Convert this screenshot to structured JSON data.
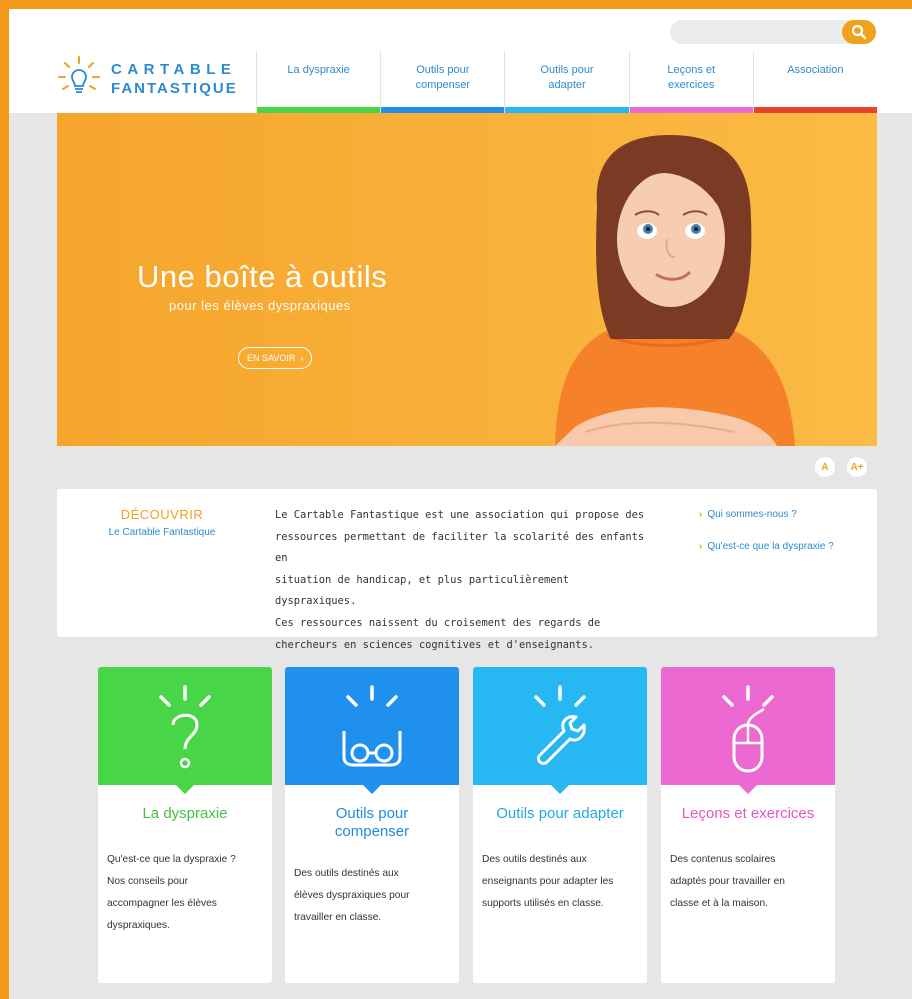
{
  "colors": {
    "frame": "#f39a1c",
    "accent_orange": "#f0a21f",
    "link_blue": "#2d8bd1",
    "green": "#48d547",
    "blue": "#1f90ee",
    "cyan": "#27b7f2",
    "pink": "#ec69d2",
    "red": "#e8422b"
  },
  "search": {
    "value": "",
    "placeholder": "",
    "icon": "search-icon"
  },
  "logo": {
    "line1": "CARTABLE",
    "line2": "FANTASTIQUE",
    "icon": "lightbulb-icon"
  },
  "nav": [
    {
      "line1": "La dyspraxie",
      "line2": "",
      "color": "#48d547"
    },
    {
      "line1": "Outils pour",
      "line2": "compenser",
      "color": "#1f90ee"
    },
    {
      "line1": "Outils pour",
      "line2": "adapter",
      "color": "#27b7f2"
    },
    {
      "line1": "Leçons et",
      "line2": "exercices",
      "color": "#ec69d2"
    },
    {
      "line1": "Association",
      "line2": "",
      "color": "#e8422b"
    }
  ],
  "hero": {
    "title": "Une boîte à outils",
    "subtitle": "pour les élèves dyspraxiques",
    "button": "EN SAVOIR",
    "button_icon": "chevron-right-icon"
  },
  "font_size": {
    "decrease": "A",
    "increase": "A+"
  },
  "discover": {
    "title": "DÉCOUVRIR",
    "subtitle": "Le Cartable Fantastique",
    "lines": [
      "Le Cartable Fantastique est une association qui propose des",
      "ressources permettant de faciliter la scolarité des enfants en",
      "situation de handicap, et plus particulièrement dyspraxiques.",
      "Ces ressources naissent du croisement des regards de",
      "chercheurs en sciences cognitives et d'enseignants."
    ],
    "links": [
      "Qui sommes-nous ?",
      "Qu'est-ce que la dyspraxie ?"
    ]
  },
  "cards": [
    {
      "title_lines": [
        "La dyspraxie"
      ],
      "text_lines": [
        "Qu'est-ce que la dyspraxie ?",
        "Nos conseils pour",
        "accompagner les élèves",
        "dyspraxiques."
      ],
      "color": "#48d547",
      "icon": "question-mark-icon"
    },
    {
      "title_lines": [
        "Outils pour",
        "compenser"
      ],
      "text_lines": [
        "Des outils destinés aux",
        "élèves dyspraxiques pour",
        "travailler en classe."
      ],
      "color": "#1f90ee",
      "icon": "glasses-icon"
    },
    {
      "title_lines": [
        "Outils pour adapter"
      ],
      "text_lines": [
        "Des outils destinés aux",
        "enseignants pour adapter les",
        "supports utilisés en classe."
      ],
      "color": "#27b7f2",
      "icon": "wrench-icon"
    },
    {
      "title_lines": [
        "Leçons et exercices"
      ],
      "text_lines": [
        "Des contenus scolaires",
        "adaptés pour travailler en",
        "classe et à la maison."
      ],
      "color": "#ec69d2",
      "icon": "mouse-icon"
    }
  ]
}
